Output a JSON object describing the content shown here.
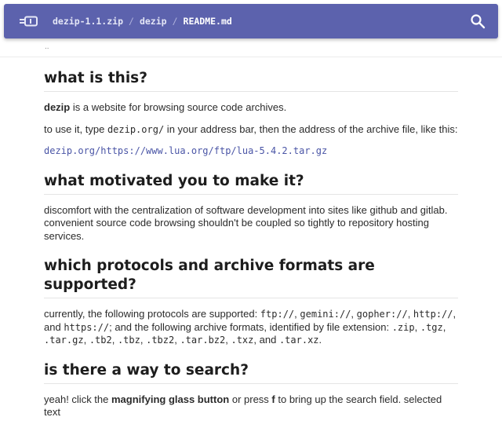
{
  "header": {
    "breadcrumb": {
      "archive": "dezip-1.1.zip",
      "folder": "dezip",
      "file": "README.md",
      "separator": "/"
    },
    "logo_icon": "zip-archive-icon",
    "search_icon": "magnifying-glass-icon",
    "accent_color": "#5c62ad"
  },
  "parent_link": "..",
  "sections": {
    "s1": {
      "heading": "what is this?",
      "p1_bold": "dezip",
      "p1_rest": " is a website for browsing source code archives.",
      "p2_a": "to use it, type ",
      "p2_code": "dezip.org/",
      "p2_b": " in your address bar, then the address of the archive file, like this:",
      "example_link": "dezip.org/https://www.lua.org/ftp/lua-5.4.2.tar.gz"
    },
    "s2": {
      "heading": "what motivated you to make it?",
      "para": "discomfort with the centralization of software development into sites like github and gitlab. convenient source code browsing shouldn't be coupled so tightly to repository hosting services."
    },
    "s3": {
      "heading": "which protocols and archive formats are supported?",
      "t1": "currently, the following protocols are supported: ",
      "ftp": "ftp://",
      "comma1": ", ",
      "gemini": "gemini://",
      "comma2": ", ",
      "gopher": "gopher://",
      "comma3": ", ",
      "http": "http://",
      "and1": ", and ",
      "https": "https://",
      "t2": "; and the following archive formats, identified by file extension: ",
      "exts": [
        ".zip",
        ".tgz",
        ".tar.gz",
        ".tb2",
        ".tbz",
        ".tbz2",
        ".tar.bz2",
        ".txz",
        ".tar.xz"
      ],
      "and2": "and",
      "end": "."
    },
    "s4": {
      "heading": "is there a way to search?",
      "t1": "yeah! click the ",
      "bold1": "magnifying glass button",
      "t2": " or press ",
      "bold2": "f",
      "t3": " to bring up the search field. selected text"
    }
  }
}
